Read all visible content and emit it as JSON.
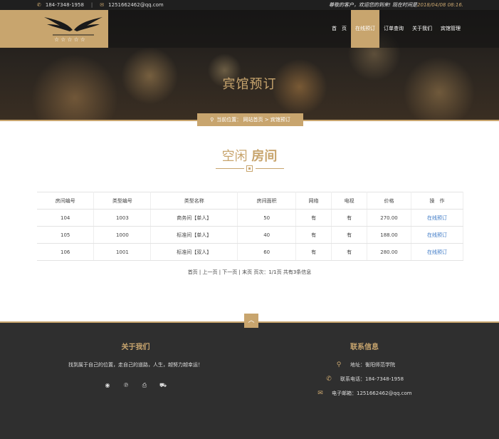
{
  "topbar": {
    "phone": "184-7348-1958",
    "email": "1251662462@qq.com",
    "welcome": "尊敬的客户，欢迎您的到来! 现在时间是",
    "time": "2018/04/08 08:16."
  },
  "nav": {
    "items": [
      {
        "label": "首　页"
      },
      {
        "label": "在线预订"
      },
      {
        "label": "订单查询"
      },
      {
        "label": "关于我们"
      },
      {
        "label": "宾馆管理"
      }
    ]
  },
  "logo": {
    "stars": "☆☆☆☆☆"
  },
  "hero": {
    "title": "宾馆预订"
  },
  "breadcrumb": {
    "text": "当前位置： 网站首页 > 宾馆预订"
  },
  "section": {
    "title_light": "空闲 ",
    "title_bold": "房间"
  },
  "table": {
    "headers": [
      "房间编号",
      "类型编号",
      "类型名称",
      "房间面积",
      "网络",
      "电视",
      "价格",
      "操　作"
    ],
    "rows": [
      [
        "104",
        "1003",
        "商务间【单人】",
        "50",
        "有",
        "有",
        "270.00",
        "在线预订"
      ],
      [
        "105",
        "1000",
        "标准间【单人】",
        "40",
        "有",
        "有",
        "188.00",
        "在线预订"
      ],
      [
        "106",
        "1001",
        "标准间【双人】",
        "60",
        "有",
        "有",
        "280.00",
        "在线预订"
      ]
    ]
  },
  "pager": {
    "text": "首页 | 上一页 | 下一页 | 末页  页次：1/1页 共有3条信息"
  },
  "footer": {
    "about_title": "关于我们",
    "about_text": "找到属于自己的位置，走自己的道路，人生，越努力越幸运！",
    "contact_title": "联系信息",
    "address": "地址：衡阳师范学院",
    "phone": "联系电话：184-7348-1958",
    "email": "电子邮箱：1251662462@qq.com"
  }
}
